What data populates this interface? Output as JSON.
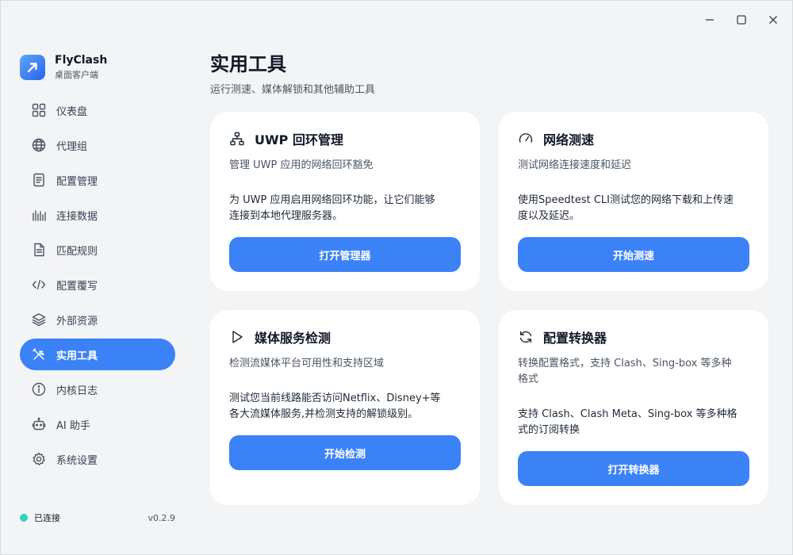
{
  "window": {
    "controls": {
      "minimize_icon": "minimize-icon",
      "maximize_icon": "maximize-icon",
      "close_icon": "close-icon"
    }
  },
  "brand": {
    "name": "FlyClash",
    "subtitle": "桌面客户端",
    "logo_icon": "arrow-up-right-icon",
    "accent_color": "#3b82f6"
  },
  "sidebar": {
    "items": [
      {
        "label": "仪表盘",
        "icon": "dashboard-grid-icon",
        "active": false
      },
      {
        "label": "代理组",
        "icon": "globe-icon",
        "active": false
      },
      {
        "label": "配置管理",
        "icon": "file-icon",
        "active": false
      },
      {
        "label": "连接数据",
        "icon": "bar-lines-icon",
        "active": false
      },
      {
        "label": "匹配规则",
        "icon": "document-icon",
        "active": false
      },
      {
        "label": "配置覆写",
        "icon": "code-icon",
        "active": false
      },
      {
        "label": "外部资源",
        "icon": "layers-icon",
        "active": false
      },
      {
        "label": "实用工具",
        "icon": "tools-icon",
        "active": true
      },
      {
        "label": "内核日志",
        "icon": "info-icon",
        "active": false
      },
      {
        "label": "AI 助手",
        "icon": "robot-icon",
        "active": false
      },
      {
        "label": "系统设置",
        "icon": "gear-icon",
        "active": false
      }
    ]
  },
  "status": {
    "text": "已连接",
    "color": "#2dd4bf",
    "version": "v0.2.9"
  },
  "page": {
    "title": "实用工具",
    "subtitle": "运行测速、媒体解锁和其他辅助工具"
  },
  "cards": {
    "uwp": {
      "icon": "network-tree-icon",
      "title": "UWP 回环管理",
      "desc": "管理 UWP 应用的网络回环豁免",
      "body_line1": "为 UWP 应用启用网络回环功能，让它们能够",
      "body_line2": "连接到本地代理服务器。",
      "button": "打开管理器"
    },
    "speed": {
      "icon": "gauge-icon",
      "title": "网络测速",
      "desc": "测试网络连接速度和延迟",
      "body_line1": "使用Speedtest CLI测试您的网络下载和上传速",
      "body_line2": "度以及延迟。",
      "button": "开始测速"
    },
    "media": {
      "icon": "play-icon",
      "title": "媒体服务检测",
      "desc": "检测流媒体平台可用性和支持区域",
      "body_line1": "测试您当前线路能否访问Netflix、Disney+等",
      "body_line2": "各大流媒体服务,并检测支持的解锁级别。",
      "button": "开始检测"
    },
    "convert": {
      "icon": "refresh-icon",
      "title": "配置转换器",
      "desc_line1": "转换配置格式，支持 Clash、Sing-box 等多种",
      "desc_line2": "格式",
      "body_line1": "支持 Clash、Clash Meta、Sing-box 等多种格",
      "body_line2": "式的订阅转换",
      "button": "打开转换器"
    }
  }
}
